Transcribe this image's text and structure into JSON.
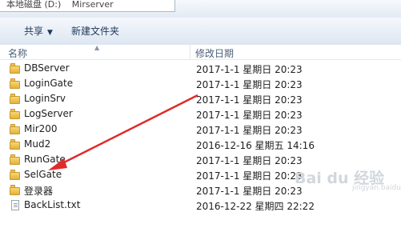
{
  "address_bar": {
    "segments": [
      "本地磁盘 (D:)",
      "Mirserver"
    ]
  },
  "toolbar": {
    "share_label": "共享",
    "new_folder_label": "新建文件夹"
  },
  "columns": {
    "name": "名称",
    "date_modified": "修改日期"
  },
  "files": [
    {
      "name": "DBServer",
      "date": "2017-1-1 星期日 20:23",
      "type": "folder"
    },
    {
      "name": "LoginGate",
      "date": "2017-1-1 星期日 20:23",
      "type": "folder"
    },
    {
      "name": "LoginSrv",
      "date": "2017-1-1 星期日 20:23",
      "type": "folder"
    },
    {
      "name": "LogServer",
      "date": "2017-1-1 星期日 20:23",
      "type": "folder"
    },
    {
      "name": "Mir200",
      "date": "2017-1-1 星期日 20:23",
      "type": "folder"
    },
    {
      "name": "Mud2",
      "date": "2016-12-16 星期五 14:16",
      "type": "folder"
    },
    {
      "name": "RunGate",
      "date": "2017-1-1 星期日 20:23",
      "type": "folder"
    },
    {
      "name": "SelGate",
      "date": "2017-1-1 星期日 20:23",
      "type": "folder"
    },
    {
      "name": "登录器",
      "date": "2017-1-1 星期日 20:23",
      "type": "folder"
    },
    {
      "name": "BackList.txt",
      "date": "2016-12-22 星期四 22:22",
      "type": "text"
    }
  ],
  "watermark": {
    "text": "Bai du 经验",
    "sub": "jingyan.baidu.com"
  },
  "colors": {
    "annotation_arrow": "#e02a2a",
    "toolbar_text": "#1e395b"
  }
}
